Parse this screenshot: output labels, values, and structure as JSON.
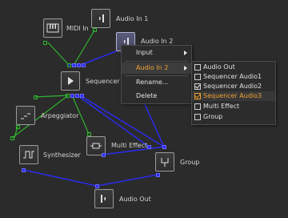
{
  "colors": {
    "background": "#2b2b2b",
    "control_wire": "#2fb52f",
    "audio_wire": "#2b2bf0",
    "highlight_text": "#f0a030"
  },
  "nodes": {
    "midi_in": {
      "label": "MIDI In",
      "icon": "piano-keys-icon"
    },
    "audio_in_1": {
      "label": "Audio In 1",
      "icon": "audio-input-icon"
    },
    "audio_in_2": {
      "label": "Audio In 2",
      "icon": "audio-input-icon"
    },
    "sequencer": {
      "label": "Sequencer",
      "icon": "play-icon"
    },
    "arpeggiator": {
      "label": "Arpeggiator",
      "icon": "arpeggio-steps-icon"
    },
    "multi_effect": {
      "label": "Multi Effect",
      "icon": "effect-box-icon"
    },
    "synthesizer": {
      "label": "Synthesizer",
      "icon": "square-wave-icon"
    },
    "group": {
      "label": "Group",
      "icon": "group-merge-icon"
    },
    "audio_out": {
      "label": "Audio Out",
      "icon": "audio-output-icon"
    }
  },
  "context_menu": {
    "items": [
      {
        "label": "Input",
        "has_submenu": true
      },
      {
        "label": "Audio In 2",
        "has_submenu": true,
        "active": true
      },
      {
        "label": "Rename..."
      },
      {
        "label": "Delete"
      }
    ]
  },
  "submenu": {
    "items": [
      {
        "label": "Audio Out",
        "checked": false
      },
      {
        "label": "Sequencer Audio1",
        "checked": false
      },
      {
        "label": "Sequencer Audio2",
        "checked": true
      },
      {
        "label": "Sequencer Audio3",
        "checked": true,
        "highlighted": true
      },
      {
        "label": "Multi Effect",
        "checked": false
      },
      {
        "label": "Group",
        "checked": false
      }
    ]
  }
}
